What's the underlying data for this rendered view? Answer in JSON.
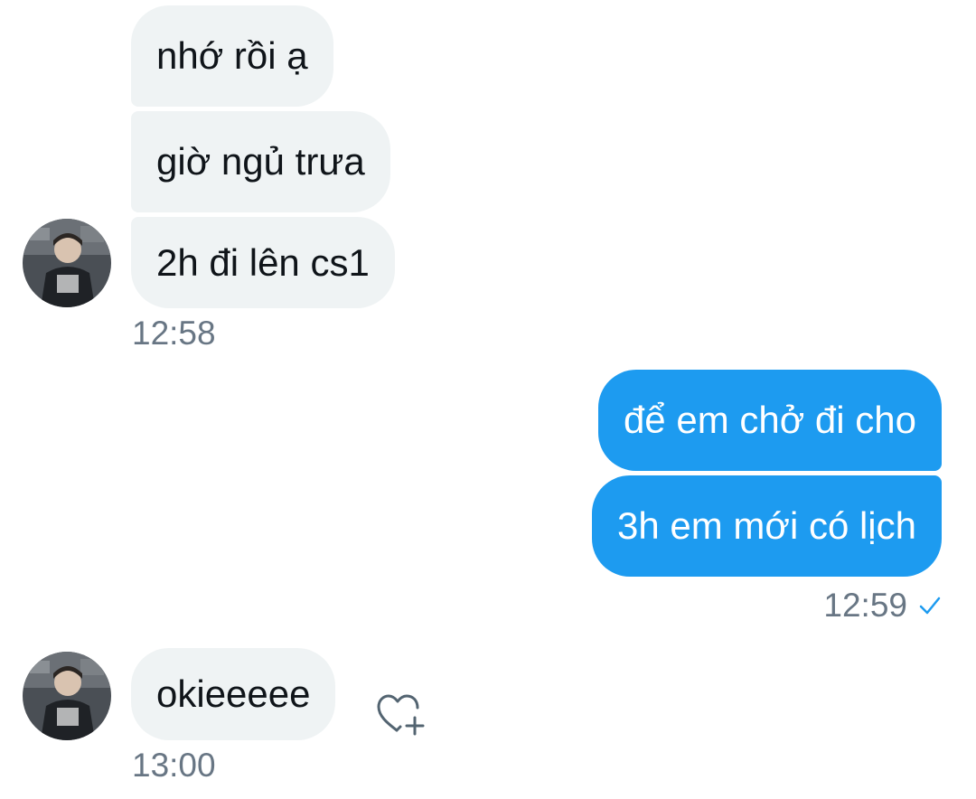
{
  "conversation": {
    "group1": {
      "messages": [
        {
          "text": "nhớ rồi ạ"
        },
        {
          "text": "giờ ngủ trưa"
        },
        {
          "text": "2h đi lên cs1"
        }
      ],
      "time": "12:58",
      "avatar_icon": "user-avatar-photo"
    },
    "group2": {
      "messages": [
        {
          "text": "để em chở đi cho"
        },
        {
          "text": "3h em mới có lịch"
        }
      ],
      "time": "12:59",
      "status_icon": "sent-check-icon"
    },
    "group3": {
      "messages": [
        {
          "text": "okieeeee"
        }
      ],
      "time": "13:00",
      "avatar_icon": "user-avatar-photo",
      "reaction_icon": "add-reaction-heart-icon"
    }
  },
  "colors": {
    "incoming_bubble": "#eff3f4",
    "outgoing_bubble": "#1d9bf0",
    "timestamp": "#687684",
    "check": "#1d9bf0"
  }
}
